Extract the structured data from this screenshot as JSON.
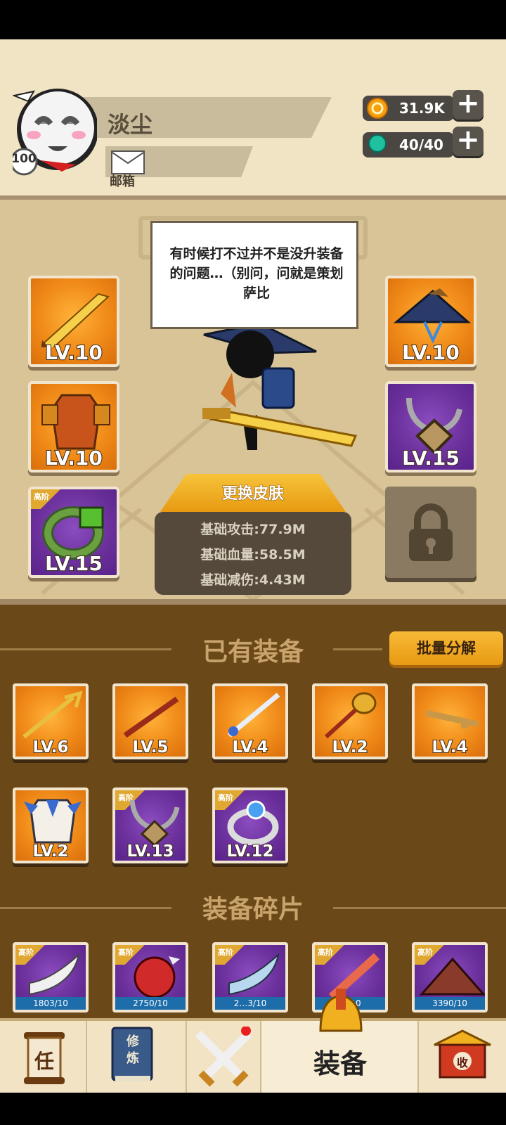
{
  "player": {
    "name": "淡尘",
    "level": "100",
    "mail_label": "邮箱"
  },
  "resources": {
    "coins": "31.9K",
    "energy": "40/40"
  },
  "equipped": {
    "left": [
      {
        "name": "weapon-sword",
        "level": "LV.10",
        "rarity": "orange"
      },
      {
        "name": "armor",
        "level": "LV.10",
        "rarity": "orange"
      },
      {
        "name": "ring",
        "level": "LV.15",
        "rarity": "purple",
        "tag": "高阶"
      }
    ],
    "right": [
      {
        "name": "hat",
        "level": "LV.10",
        "rarity": "orange"
      },
      {
        "name": "necklace",
        "level": "LV.15",
        "rarity": "purple"
      }
    ]
  },
  "tip_text": "有时候打不过并不是没升装备的问题…（别问，问就是策划萨比",
  "change_skin_label": "更换皮肤",
  "stats": [
    "基础攻击:77.9M",
    "基础血量:58.5M",
    "基础减伤:4.43M"
  ],
  "owned_section_title": "已有装备",
  "batch_dismantle_label": "批量分解",
  "owned_items": [
    {
      "name": "trident",
      "level": "LV.6",
      "rarity": "orange"
    },
    {
      "name": "staff",
      "level": "LV.5",
      "rarity": "orange"
    },
    {
      "name": "blue-sword",
      "level": "LV.4",
      "rarity": "orange"
    },
    {
      "name": "mace",
      "level": "LV.2",
      "rarity": "orange"
    },
    {
      "name": "key-blade",
      "level": "LV.4",
      "rarity": "orange"
    },
    {
      "name": "blue-armor",
      "level": "LV.2",
      "rarity": "orange"
    },
    {
      "name": "necklace",
      "level": "LV.13",
      "rarity": "purple",
      "tag": "高阶",
      "locked": true
    },
    {
      "name": "sapphire-ring",
      "level": "LV.12",
      "rarity": "purple",
      "tag": "高阶",
      "locked": true
    }
  ],
  "fragments_section_title": "装备碎片",
  "fragments": [
    {
      "name": "white-blade",
      "count": "1803/10",
      "tag": "高阶"
    },
    {
      "name": "red-armor",
      "count": "2750/10",
      "tag": "高阶"
    },
    {
      "name": "blue-blade",
      "count": "2…3/10",
      "tag": "高阶"
    },
    {
      "name": "red-sword",
      "count": "…/10",
      "tag": "高阶"
    },
    {
      "name": "red-hat",
      "count": "3390/10",
      "tag": "高阶"
    }
  ],
  "nav": {
    "task_glyph": "任",
    "cultivate_glyph": "修炼",
    "equipment_label": "装备",
    "collect_glyph": "收"
  },
  "colors": {
    "header_bg": "#f1e4c5",
    "panel_bg": "#d8c497",
    "bag_bg": "#6b4818",
    "orange_rarity": "#f08a18",
    "purple_rarity": "#6a2f9a",
    "accent_button": "#f0a424"
  }
}
